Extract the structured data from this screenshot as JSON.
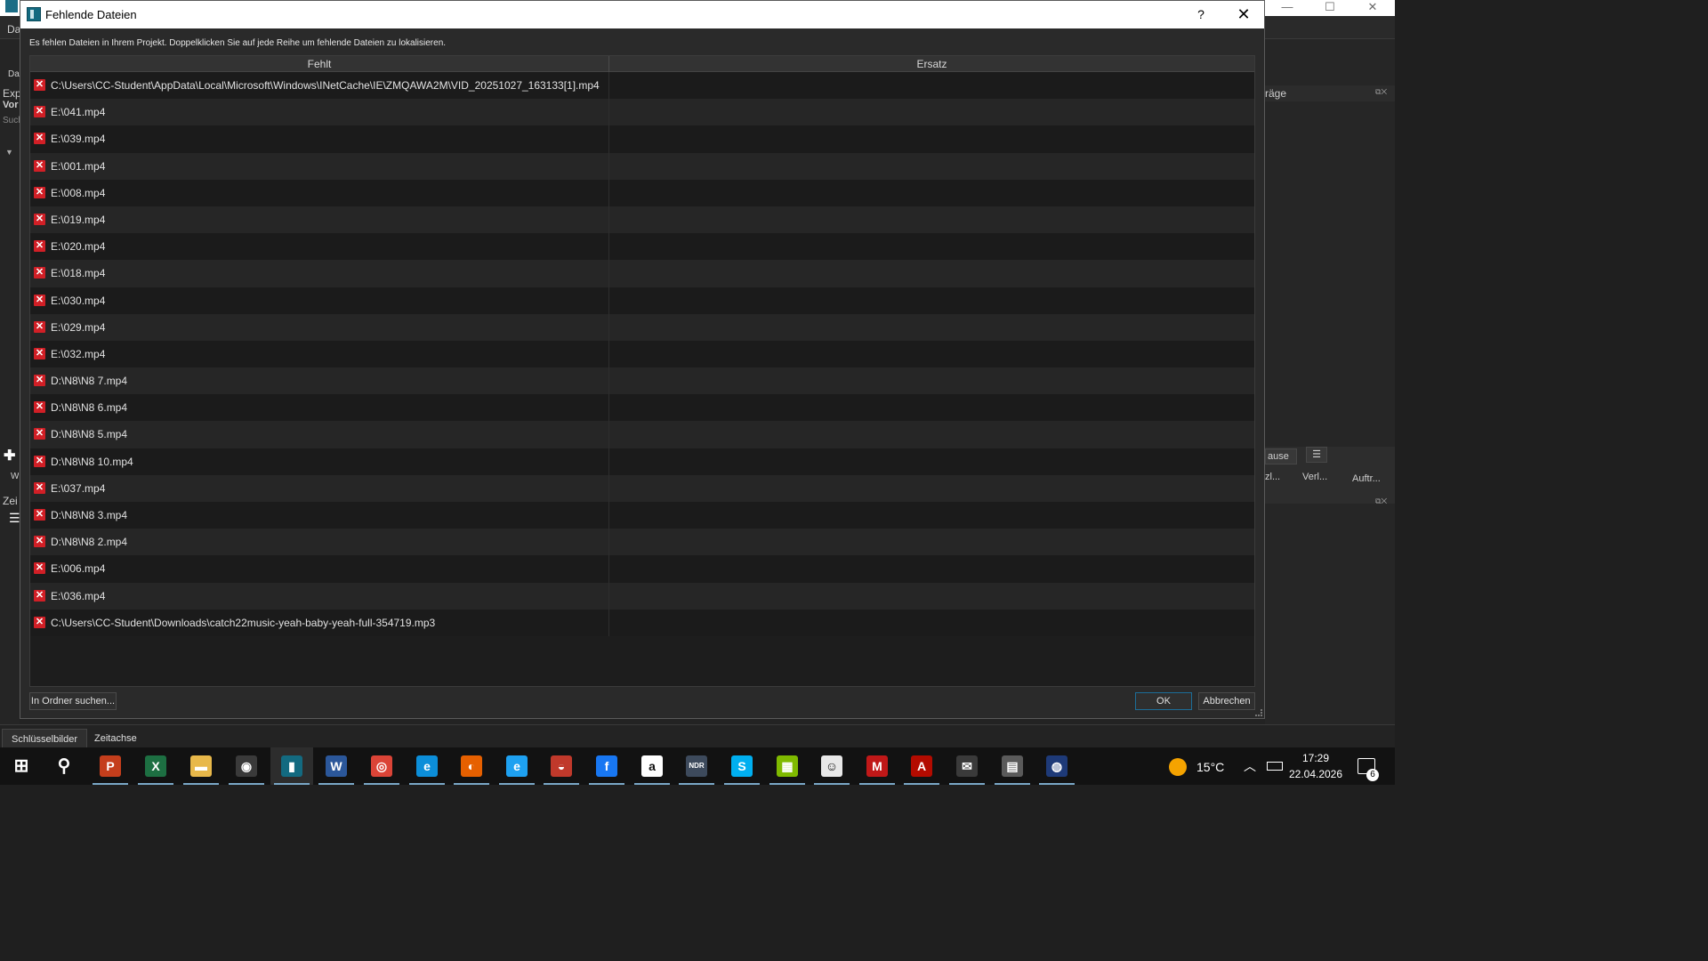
{
  "background_app": {
    "fragments": {
      "menu_da": "Da",
      "da2": "Da",
      "exp": "Exp",
      "vor": "Vor",
      "such": "Such",
      "w": "W",
      "zei": "Zei",
      "right_title": "räge",
      "pause": "ause",
      "zl": "zl...",
      "verl": "Verl...",
      "auftr": "Auftr..."
    },
    "bottom_tabs": [
      "Schlüsselbilder",
      "Zeitachse"
    ]
  },
  "dialog": {
    "title": "Fehlende Dateien",
    "help_glyph": "?",
    "close_glyph": "✕",
    "message": "Es fehlen Dateien in Ihrem Projekt. Doppelklicken Sie auf jede Reihe um fehlende Dateien zu lokalisieren.",
    "columns": [
      "Fehlt",
      "Ersatz"
    ],
    "rows": [
      {
        "missing": "C:\\Users\\CC-Student\\AppData\\Local\\Microsoft\\Windows\\INetCache\\IE\\ZMQAWA2M\\VID_20251027_163133[1].mp4",
        "replacement": ""
      },
      {
        "missing": "E:\\041.mp4",
        "replacement": ""
      },
      {
        "missing": "E:\\039.mp4",
        "replacement": ""
      },
      {
        "missing": "E:\\001.mp4",
        "replacement": ""
      },
      {
        "missing": "E:\\008.mp4",
        "replacement": ""
      },
      {
        "missing": "E:\\019.mp4",
        "replacement": ""
      },
      {
        "missing": "E:\\020.mp4",
        "replacement": ""
      },
      {
        "missing": "E:\\018.mp4",
        "replacement": ""
      },
      {
        "missing": "E:\\030.mp4",
        "replacement": ""
      },
      {
        "missing": "E:\\029.mp4",
        "replacement": ""
      },
      {
        "missing": "E:\\032.mp4",
        "replacement": ""
      },
      {
        "missing": "D:\\N8\\N8 7.mp4",
        "replacement": ""
      },
      {
        "missing": "D:\\N8\\N8 6.mp4",
        "replacement": ""
      },
      {
        "missing": "D:\\N8\\N8 5.mp4",
        "replacement": ""
      },
      {
        "missing": "D:\\N8\\N8 10.mp4",
        "replacement": ""
      },
      {
        "missing": "E:\\037.mp4",
        "replacement": ""
      },
      {
        "missing": "D:\\N8\\N8 3.mp4",
        "replacement": ""
      },
      {
        "missing": "D:\\N8\\N8 2.mp4",
        "replacement": ""
      },
      {
        "missing": "E:\\006.mp4",
        "replacement": ""
      },
      {
        "missing": "E:\\036.mp4",
        "replacement": ""
      },
      {
        "missing": "C:\\Users\\CC-Student\\Downloads\\catch22music-yeah-baby-yeah-full-354719.mp3",
        "replacement": ""
      }
    ],
    "buttons": {
      "find_in_folder": "In Ordner suchen...",
      "ok": "OK",
      "cancel": "Abbrechen"
    }
  },
  "taskbar": {
    "apps": [
      {
        "name": "start",
        "glyph": "⊞",
        "color": "#121212"
      },
      {
        "name": "search",
        "glyph": "⚲",
        "color": "#121212"
      },
      {
        "name": "powerpoint",
        "glyph": "P",
        "color": "#c43e1c"
      },
      {
        "name": "excel",
        "glyph": "X",
        "color": "#1d6f42"
      },
      {
        "name": "file-explorer",
        "glyph": "▬",
        "color": "#e8b84a"
      },
      {
        "name": "camera",
        "glyph": "◉",
        "color": "#3a3a3a"
      },
      {
        "name": "openshot",
        "glyph": "▮",
        "color": "#136a80"
      },
      {
        "name": "word",
        "glyph": "W",
        "color": "#2b579a"
      },
      {
        "name": "chrome",
        "glyph": "◎",
        "color": "#db4437"
      },
      {
        "name": "edge",
        "glyph": "e",
        "color": "#0c8ed9"
      },
      {
        "name": "firefox",
        "glyph": "◐",
        "color": "#e66000"
      },
      {
        "name": "internet-explorer",
        "glyph": "e",
        "color": "#1ea1f1"
      },
      {
        "name": "media-player",
        "glyph": "◒",
        "color": "#c0392b"
      },
      {
        "name": "facebook",
        "glyph": "f",
        "color": "#1877f2"
      },
      {
        "name": "amazon",
        "glyph": "a",
        "color": "#ffffff"
      },
      {
        "name": "ndr",
        "glyph": "NDR",
        "color": "#3d4a5c"
      },
      {
        "name": "skype",
        "glyph": "S",
        "color": "#00aff0"
      },
      {
        "name": "microsoft-store",
        "glyph": "▦",
        "color": "#7fba00"
      },
      {
        "name": "avatar-app",
        "glyph": "☺",
        "color": "#e8e8e8"
      },
      {
        "name": "mcafee",
        "glyph": "M",
        "color": "#c01818"
      },
      {
        "name": "acrobat",
        "glyph": "A",
        "color": "#b30b00"
      },
      {
        "name": "chat-app",
        "glyph": "✉",
        "color": "#3a3a3a"
      },
      {
        "name": "printer-app",
        "glyph": "▤",
        "color": "#5a5a5a"
      },
      {
        "name": "steam-like-app",
        "glyph": "◍",
        "color": "#1e3a78"
      }
    ],
    "tray": {
      "temperature": "15°C",
      "time": "17:29",
      "date": "22.04.2026",
      "notification_count": "6"
    }
  }
}
